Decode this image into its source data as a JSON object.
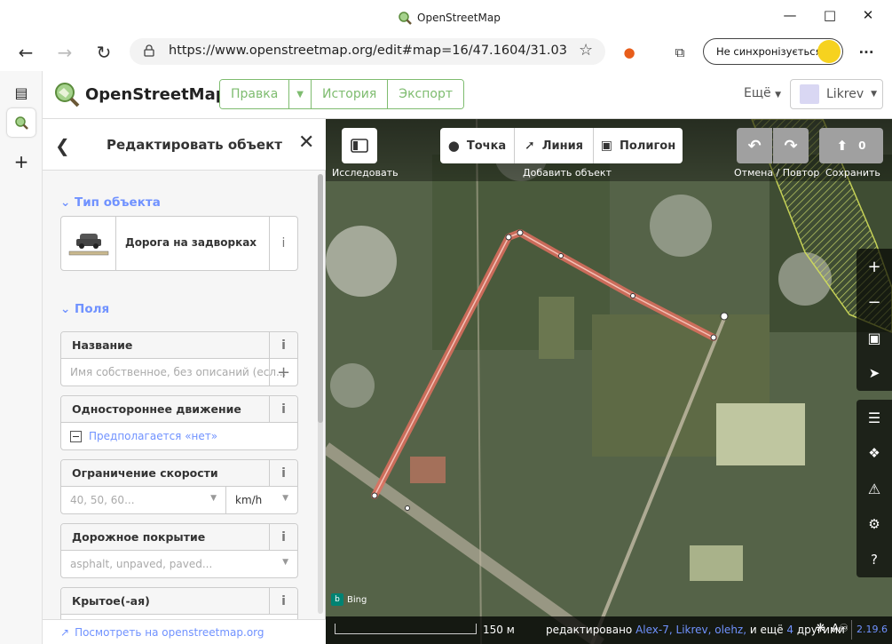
{
  "browser": {
    "window_title": "OpenStreetMap",
    "url": "https://www.openstreetmap.org/edit#map=16/47.1604/31.03...",
    "sync_label": "Не синхронізується",
    "more_label": "···"
  },
  "osm": {
    "logo_text": "OpenStreetMap",
    "nav": {
      "edit": "Правка",
      "history": "История",
      "export": "Экспорт"
    },
    "more": "Ещё",
    "user": "Likrev"
  },
  "sidebar": {
    "title": "Редактировать объект",
    "type_section": "Тип объекта",
    "preset_name": "Дорога на задворках",
    "fields_section": "Поля",
    "fields": {
      "name": {
        "label": "Название",
        "placeholder": "Имя собственное, без описаний (есл..."
      },
      "oneway": {
        "label": "Одностороннее движение",
        "value": "Предполагается «нет»"
      },
      "maxspeed": {
        "label": "Ограничение скорости",
        "placeholder": "40, 50, 60...",
        "unit": "km/h"
      },
      "surface": {
        "label": "Дорожное покрытие",
        "placeholder": "asphalt, unpaved, paved..."
      },
      "covered": {
        "label": "Крытое(-ая)"
      }
    },
    "view_link": "Посмотреть на openstreetmap.org"
  },
  "map": {
    "browse_label": "Исследовать",
    "point": "Точка",
    "line": "Линия",
    "area": "Полигон",
    "add_feature_label": "Добавить объект",
    "undo_redo_label": "Отмена / Повтор",
    "save_label": "Сохранить",
    "save_count": "0",
    "imagery": "Bing",
    "scale": "150 м",
    "attribution_prefix": "редактировано",
    "editors": "Alex-7, Likrev, olehz,",
    "and_more": "и ещё",
    "others_count": "4",
    "others_word": "другими",
    "version": "2.19.6"
  },
  "colors": {
    "osm_green": "#7ebc6f",
    "link_blue": "#7092ff",
    "selected_way": "#e06e5f"
  }
}
